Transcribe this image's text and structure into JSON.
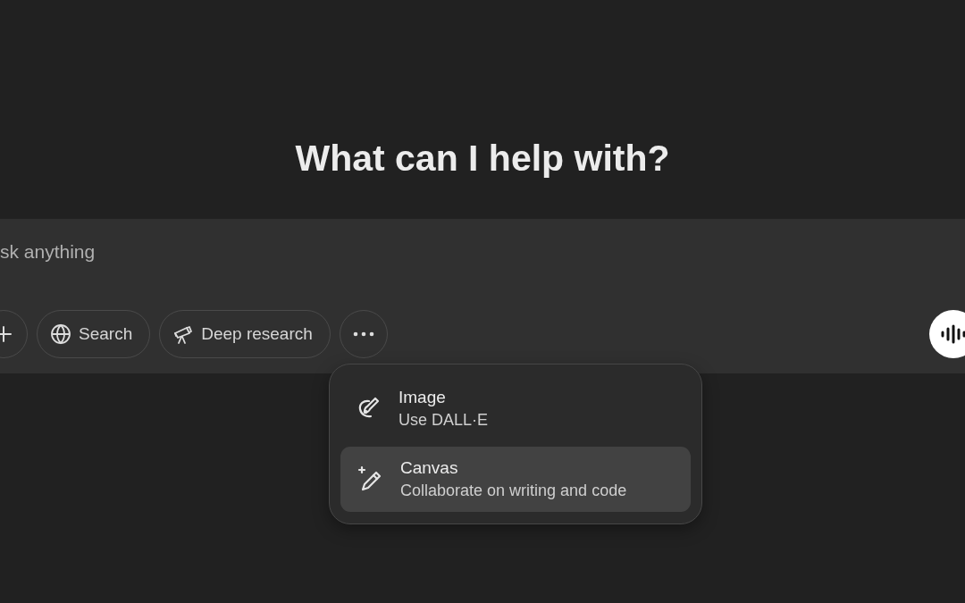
{
  "heading": "What can I help with?",
  "composer": {
    "placeholder": "sk anything",
    "tools": [
      {
        "kind": "plus"
      },
      {
        "kind": "search",
        "label": "Search"
      },
      {
        "kind": "research",
        "label": "Deep research"
      },
      {
        "kind": "more"
      }
    ],
    "voice": {
      "kind": "voice"
    }
  },
  "menu": {
    "items": [
      {
        "kind": "image",
        "title": "Image",
        "subtitle": "Use DALL·E",
        "selected": false
      },
      {
        "kind": "canvas",
        "title": "Canvas",
        "subtitle": "Collaborate on writing and code",
        "selected": true
      }
    ]
  }
}
